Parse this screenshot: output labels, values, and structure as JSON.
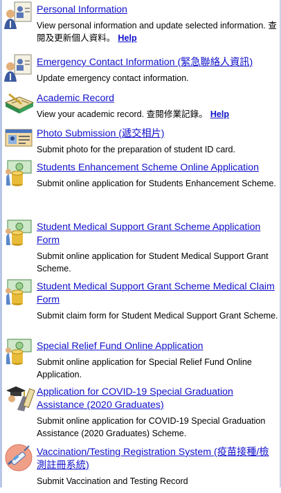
{
  "items": [
    {
      "title": "Personal Information",
      "desc": "View personal information and update selected information. 查閱及更新個人資料。",
      "help": "Help",
      "icon": "person-profile-icon"
    },
    {
      "title": "Emergency Contact Information (緊急聯絡人資訊)",
      "desc": "Update emergency contact information.",
      "icon": "person-profile-icon"
    },
    {
      "title": "Academic Record",
      "desc": "View your academic record. 查閱修業記錄。",
      "help": "Help",
      "icon": "book-icon"
    },
    {
      "title": "Photo Submission (遞交相片)",
      "desc": "Submit photo for the preparation of student ID card.",
      "icon": "id-card-icon"
    },
    {
      "title": "Students Enhancement Scheme Online Application",
      "desc": "Submit online application for Students Enhancement Scheme.",
      "icon": "money-coins-icon"
    },
    {
      "title": "Student Medical Support Grant Scheme Application Form",
      "desc": "Submit online application for Student Medical Support Grant Scheme.",
      "icon": "money-coins-icon"
    },
    {
      "title": "Student Medical Support Grant Scheme Medical Claim Form",
      "desc": "Submit claim form for Student Medical Support Grant Scheme.",
      "icon": "money-coins-icon"
    },
    {
      "title": "Special Relief Fund Online Application",
      "desc": "Submit online application for Special Relief Fund Online Application.",
      "icon": "money-coins-icon"
    },
    {
      "title": "Application for COVID-19 Special Graduation Assistance (2020 Graduates)",
      "desc": "Submit online application for COVID-19 Special Graduation Assistance (2020 Graduates) Scheme.",
      "icon": "graduation-icon"
    },
    {
      "title": "Vaccination/Testing Registration System (疫苗接種/檢測註冊系統)",
      "desc": "Submit Vaccination and Testing Record",
      "icon": "syringe-icon"
    }
  ],
  "colors": {
    "link": "#1010cc",
    "frame": "#b9c7e6"
  }
}
